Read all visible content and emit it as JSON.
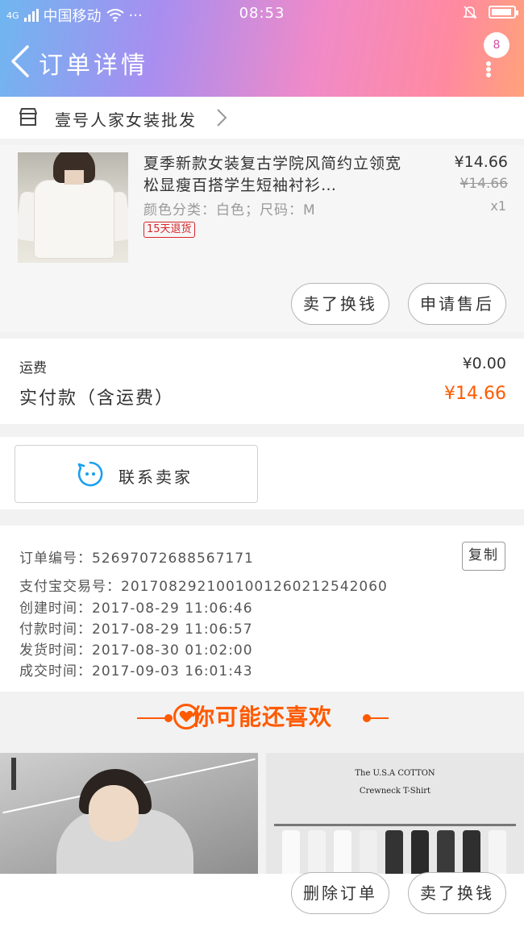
{
  "status_bar": {
    "network": "4G",
    "carrier": "中国移动",
    "more": "···",
    "time": "08:53"
  },
  "header": {
    "title": "订单详情",
    "message_count": "8"
  },
  "shop": {
    "name": "壹号人家女装批发"
  },
  "product": {
    "title": "夏季新款女装复古学院风简约立领宽松显瘦百搭学生短袖衬衫…",
    "spec": "颜色分类：白色；尺码：M",
    "tag": "15天退货",
    "price": "¥14.66",
    "original_price": "¥14.66",
    "quantity": "x1",
    "sell_button": "卖了换钱",
    "after_sale_button": "申请售后"
  },
  "fees": {
    "freight_label": "运费",
    "freight_value": "¥0.00",
    "paid_label": "实付款（含运费）",
    "paid_value": "¥14.66"
  },
  "contact": {
    "label": "联系卖家"
  },
  "order_info": {
    "order_no": "订单编号：52697072688567171",
    "copy_button": "复制",
    "alipay_no": "支付宝交易号：2017082921001001260212542060",
    "created": "创建时间：2017-08-29 11:06:46",
    "paid": "付款时间：2017-08-29 11:06:57",
    "shipped": "发货时间：2017-08-30 01:02:00",
    "completed": "成交时间：2017-09-03 16:01:43"
  },
  "recommend": {
    "title": "你可能还喜欢",
    "item2_line1": "The U.S.A COTTON",
    "item2_line2": "Crewneck T-Shirt"
  },
  "bottom": {
    "delete_button": "删除订单",
    "sell_button": "卖了换钱"
  },
  "colors": {
    "accent": "#ff5a00",
    "tag_red": "#d9262c",
    "contact_icon": "#1aa0f0"
  }
}
